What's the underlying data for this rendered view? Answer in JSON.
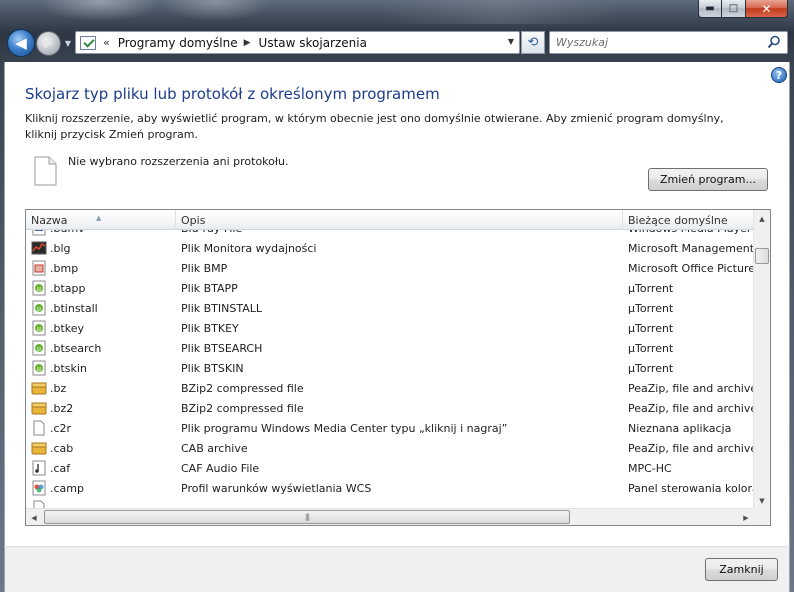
{
  "window": {
    "minimize_glyph": "▬",
    "maximize_glyph": "□",
    "close_glyph": "✕"
  },
  "nav": {
    "back_glyph": "◀",
    "forward_glyph": "▶",
    "dropdown_glyph": "▼"
  },
  "address": {
    "chevrons": "«",
    "crumbs": [
      "Programy domyślne",
      "Ustaw skojarzenia"
    ],
    "separator": "▶",
    "dropdown_glyph": "▼"
  },
  "refresh_glyph": "⟲",
  "search": {
    "placeholder": "Wyszukaj"
  },
  "help_glyph": "?",
  "page": {
    "title": "Skojarz typ pliku lub protokół z określonym programem",
    "description": "Kliknij rozszerzenie, aby wyświetlić program, w którym obecnie jest ono domyślnie otwierane. Aby zmienić program domyślny, kliknij przycisk Zmień program.",
    "status": "Nie wybrano rozszerzenia ani protokołu.",
    "change_button": "Zmień program..."
  },
  "table": {
    "columns": [
      "Nazwa",
      "Opis",
      "Bieżące domyślne"
    ],
    "rows": [
      {
        "ext": ".bdmv",
        "desc": "Blu-ray File",
        "current": "Windows Media Player",
        "icon": "bluray-file-icon"
      },
      {
        "ext": ".blg",
        "desc": "Plik Monitora wydajności",
        "current": "Microsoft Management",
        "icon": "perfmon-file-icon"
      },
      {
        "ext": ".bmp",
        "desc": "Plik BMP",
        "current": "Microsoft Office Picture",
        "icon": "image-file-icon"
      },
      {
        "ext": ".btapp",
        "desc": "Plik BTAPP",
        "current": "µTorrent",
        "icon": "utorrent-file-icon"
      },
      {
        "ext": ".btinstall",
        "desc": "Plik BTINSTALL",
        "current": "µTorrent",
        "icon": "utorrent-file-icon"
      },
      {
        "ext": ".btkey",
        "desc": "Plik BTKEY",
        "current": "µTorrent",
        "icon": "utorrent-file-icon"
      },
      {
        "ext": ".btsearch",
        "desc": "Plik BTSEARCH",
        "current": "µTorrent",
        "icon": "utorrent-file-icon"
      },
      {
        "ext": ".btskin",
        "desc": "Plik BTSKIN",
        "current": "µTorrent",
        "icon": "utorrent-file-icon"
      },
      {
        "ext": ".bz",
        "desc": "BZip2 compressed file",
        "current": "PeaZip, file and archive",
        "icon": "archive-file-icon"
      },
      {
        "ext": ".bz2",
        "desc": "BZip2 compressed file",
        "current": "PeaZip, file and archive",
        "icon": "archive-file-icon"
      },
      {
        "ext": ".c2r",
        "desc": "Plik programu Windows Media Center typu „kliknij i nagraj”",
        "current": "Nieznana aplikacja",
        "icon": "blank-file-icon"
      },
      {
        "ext": ".cab",
        "desc": "CAB archive",
        "current": "PeaZip, file and archive",
        "icon": "archive-file-icon"
      },
      {
        "ext": ".caf",
        "desc": "CAF Audio File",
        "current": "MPC-HC",
        "icon": "audio-file-icon"
      },
      {
        "ext": ".camp",
        "desc": "Profil warunków wyświetlania WCS",
        "current": "Panel sterowania kolora",
        "icon": "color-profile-file-icon"
      },
      {
        "ext": "",
        "desc": "",
        "current": "",
        "icon": "blank-file-icon"
      }
    ]
  },
  "scroll": {
    "up_glyph": "▲",
    "down_glyph": "▼",
    "left_glyph": "◀",
    "right_glyph": "▶",
    "grip_glyph": "|||"
  },
  "footer": {
    "close_button": "Zamknij"
  }
}
